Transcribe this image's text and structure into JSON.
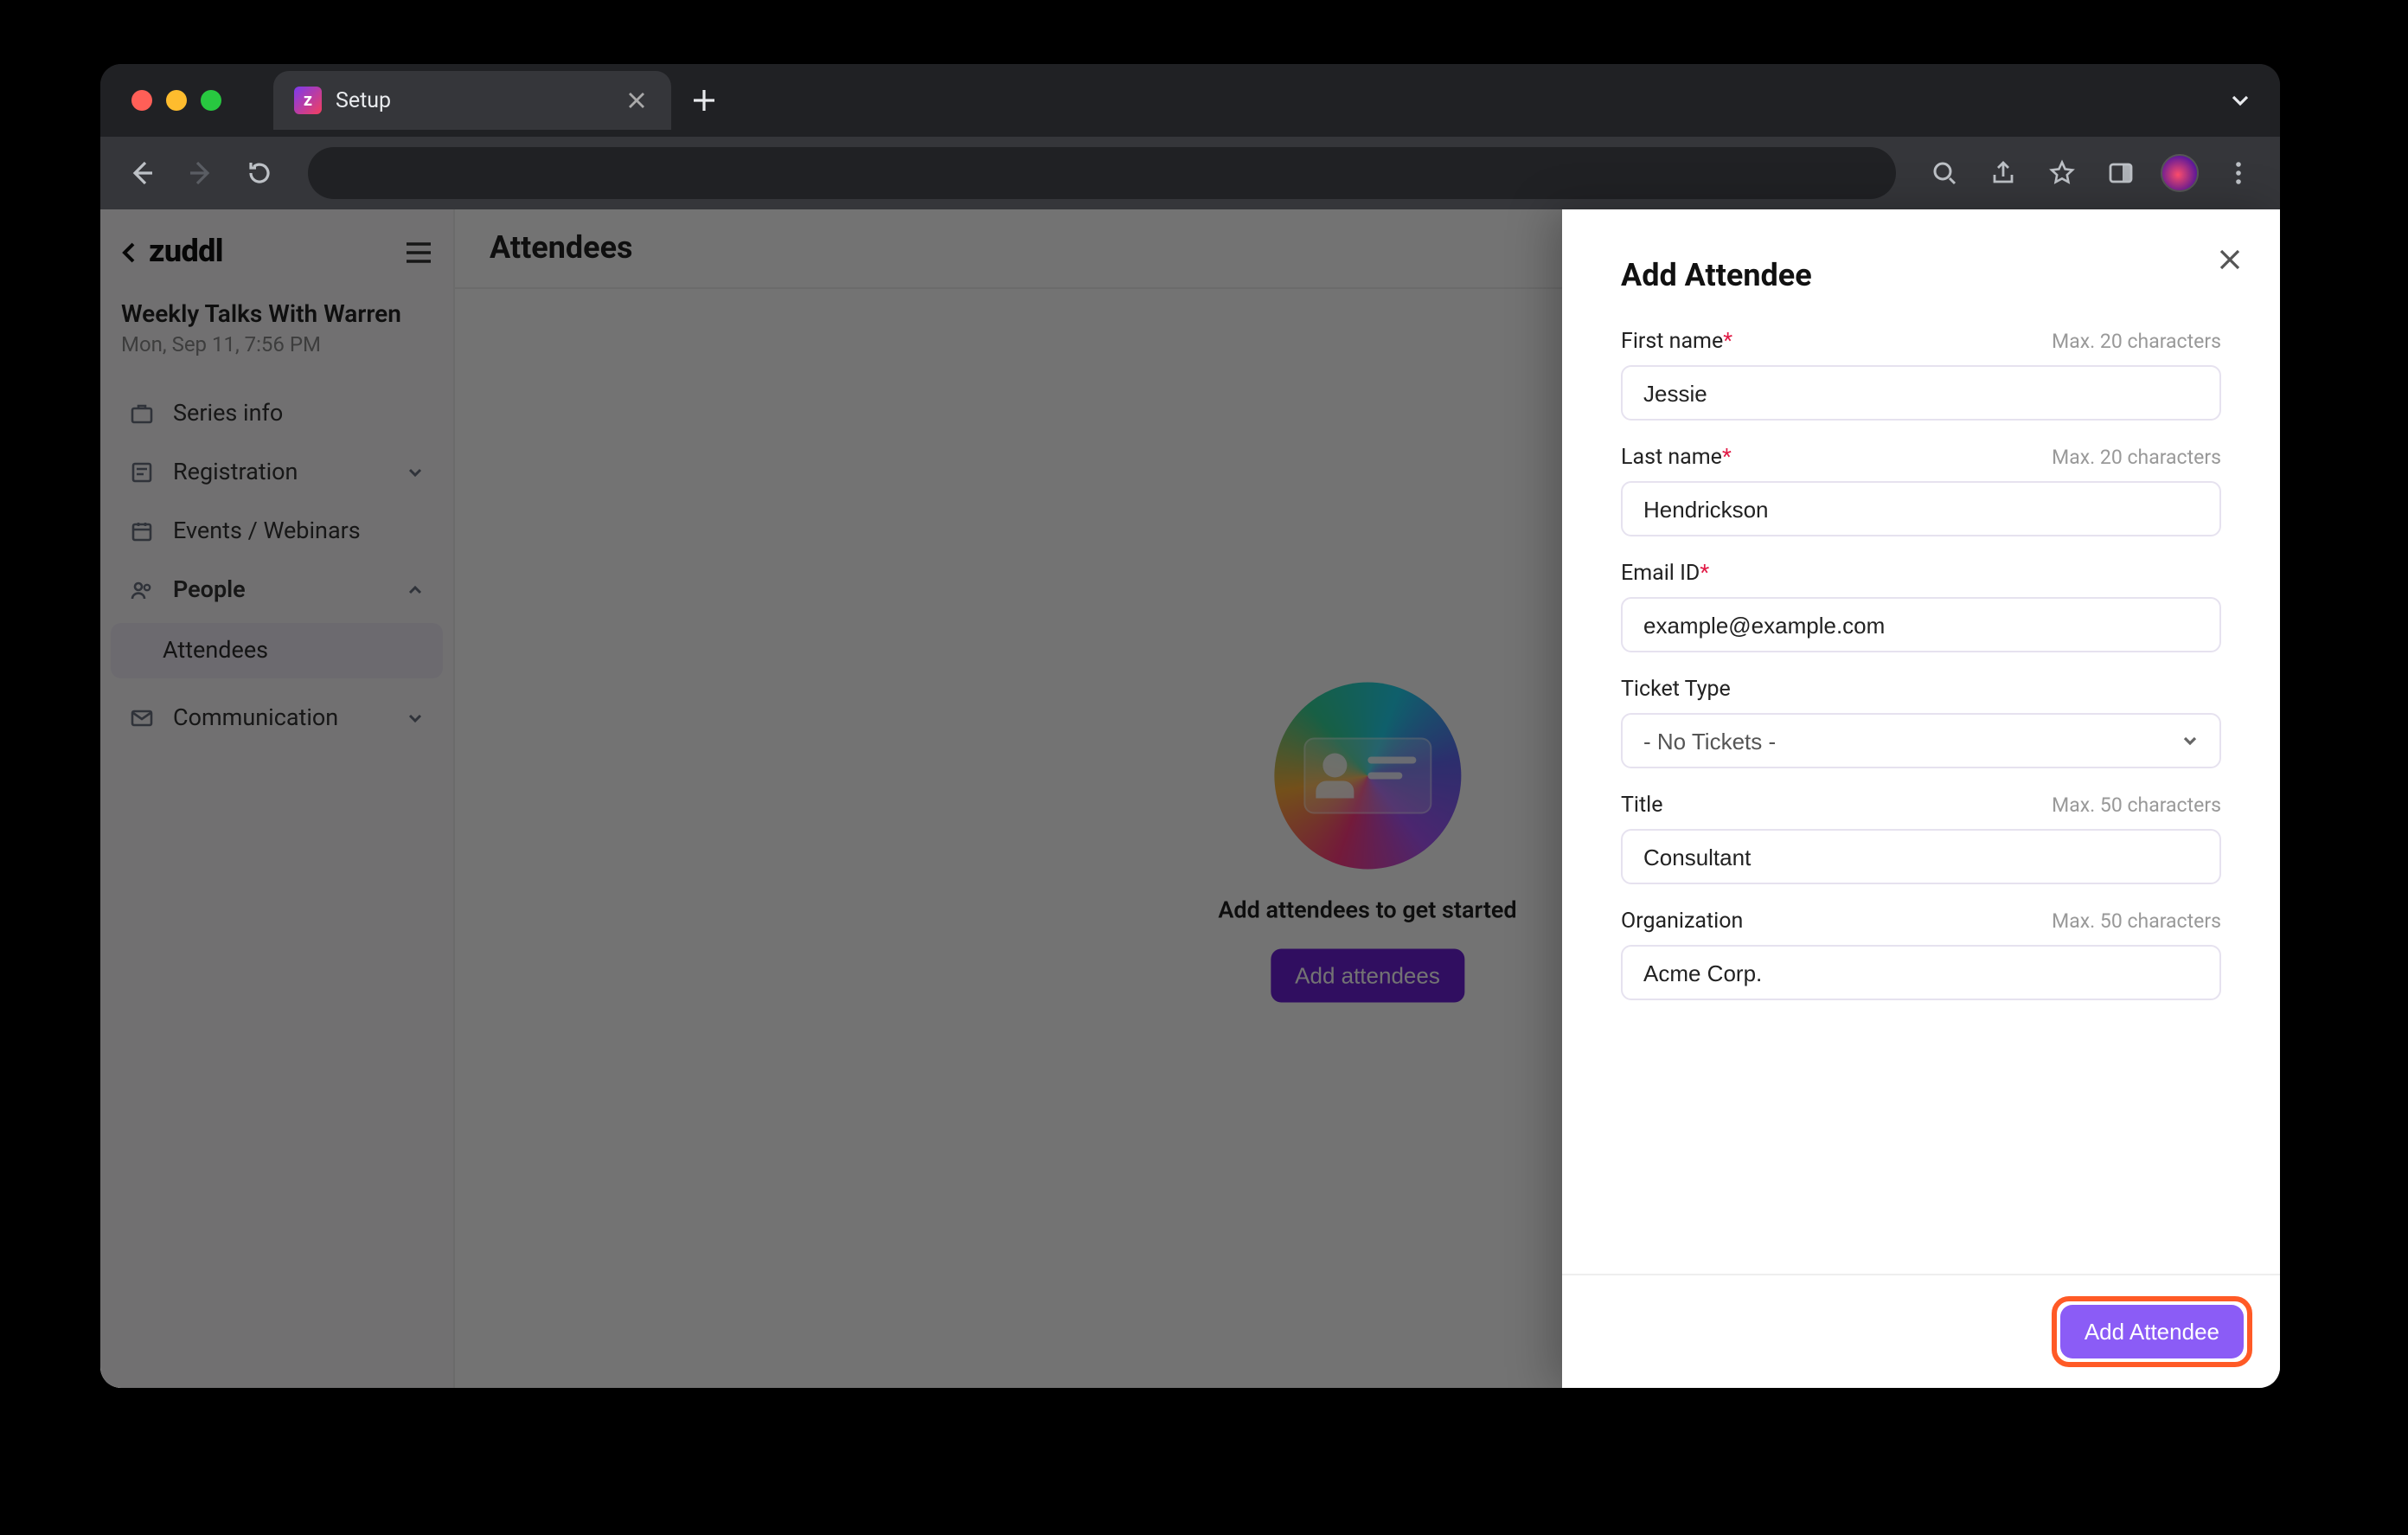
{
  "browser": {
    "tab_title": "Setup"
  },
  "sidebar": {
    "brand": "zuddl",
    "event_title": "Weekly Talks With Warren",
    "event_time": "Mon, Sep 11, 7:56 PM",
    "series_info": "Series info",
    "registration": "Registration",
    "events": "Events / Webinars",
    "people": "People",
    "attendees": "Attendees",
    "communication": "Communication"
  },
  "main": {
    "title": "Attendees",
    "empty_heading": "Add attendees to get started",
    "cta": "Add attendees"
  },
  "drawer": {
    "title": "Add Attendee",
    "first_name": {
      "label": "First name",
      "hint": "Max. 20 characters",
      "value": "Jessie"
    },
    "last_name": {
      "label": "Last name",
      "hint": "Max. 20 characters",
      "value": "Hendrickson"
    },
    "email": {
      "label": "Email ID",
      "value": "example@example.com"
    },
    "ticket": {
      "label": "Ticket Type",
      "selected": "- No Tickets -"
    },
    "title_f": {
      "label": "Title",
      "hint": "Max. 50 characters",
      "value": "Consultant"
    },
    "org": {
      "label": "Organization",
      "hint": "Max. 50 characters",
      "value": "Acme Corp."
    },
    "submit": "Add Attendee"
  }
}
